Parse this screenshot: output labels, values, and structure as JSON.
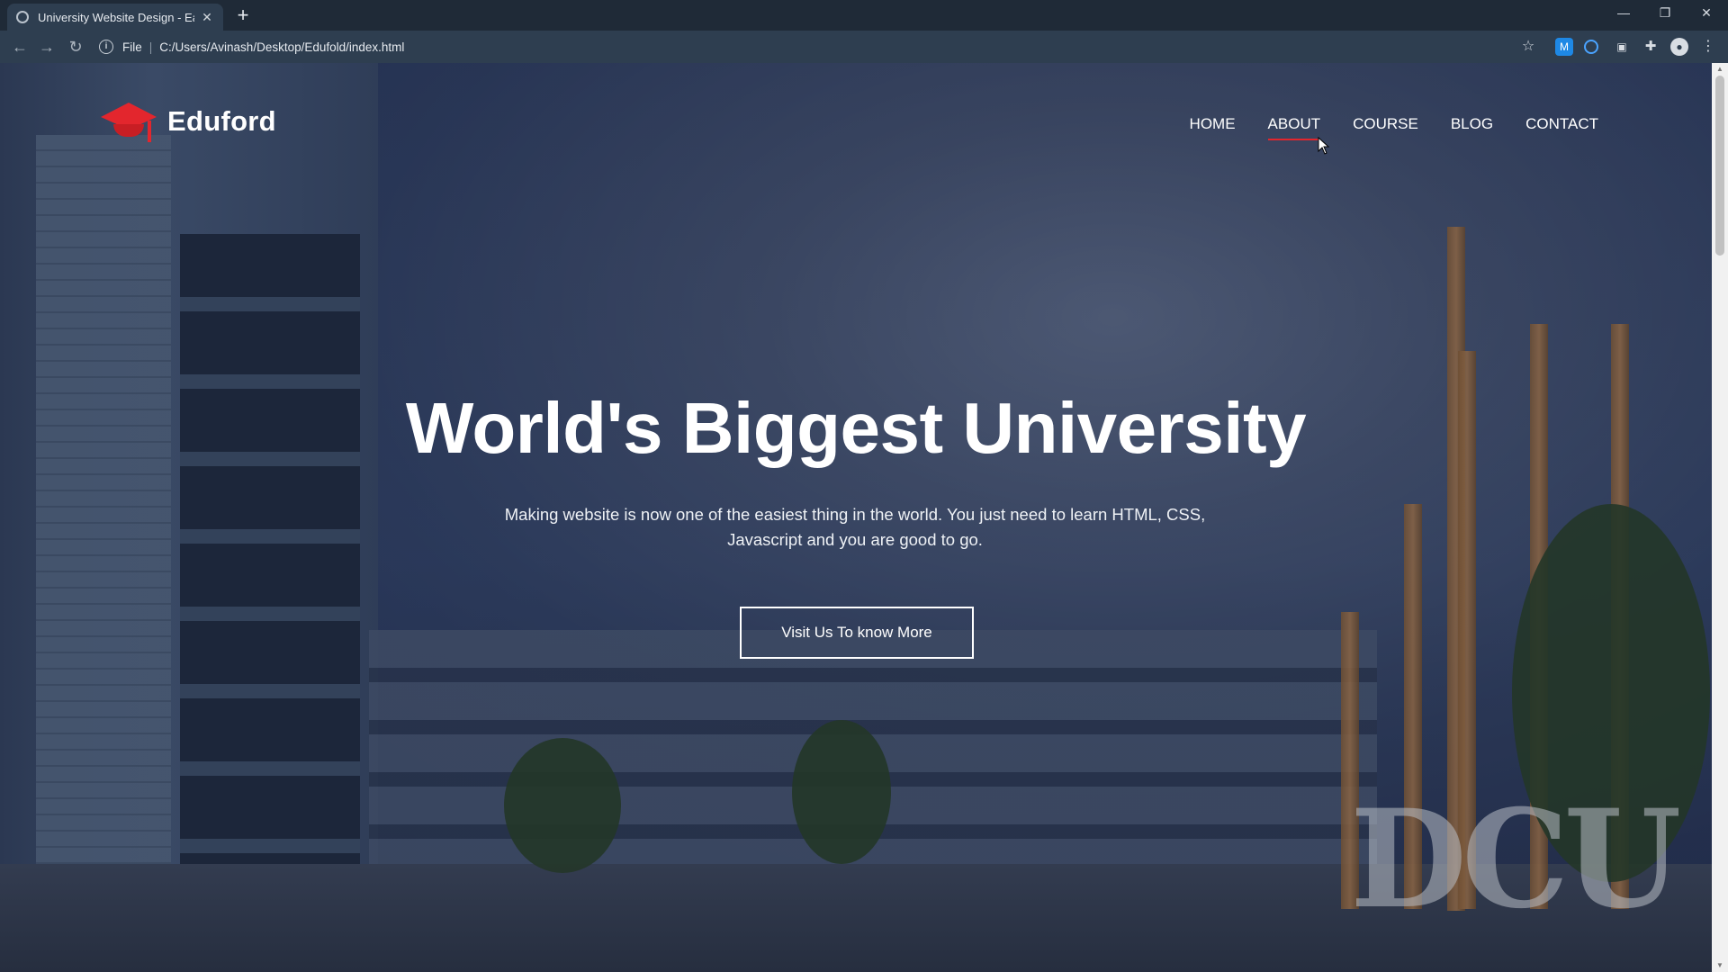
{
  "browser": {
    "tab_title": "University Website Design - Easy",
    "new_tab_label": "+",
    "address_scheme": "File",
    "address_path": "C:/Users/Avinash/Desktop/Edufold/index.html",
    "icons": {
      "back": "arrow-left-icon",
      "forward": "arrow-right-icon",
      "reload": "reload-icon",
      "info": "info-icon",
      "bookmark": "star-icon",
      "extensions": "puzzle-icon",
      "profile": "avatar-icon",
      "menu": "kebab-menu-icon"
    }
  },
  "site": {
    "brand": "Eduford",
    "brand_color": "#e3262d",
    "nav": [
      {
        "label": "HOME"
      },
      {
        "label": "ABOUT",
        "active": true
      },
      {
        "label": "COURSE"
      },
      {
        "label": "BLOG"
      },
      {
        "label": "CONTACT"
      }
    ],
    "hero": {
      "title": "World's Biggest University",
      "text": "Making website is now one of the easiest thing in the world. You just need to learn HTML, CSS, Javascript and you are good to go.",
      "button": "Visit Us To know More"
    },
    "background_sign": "DCU"
  }
}
